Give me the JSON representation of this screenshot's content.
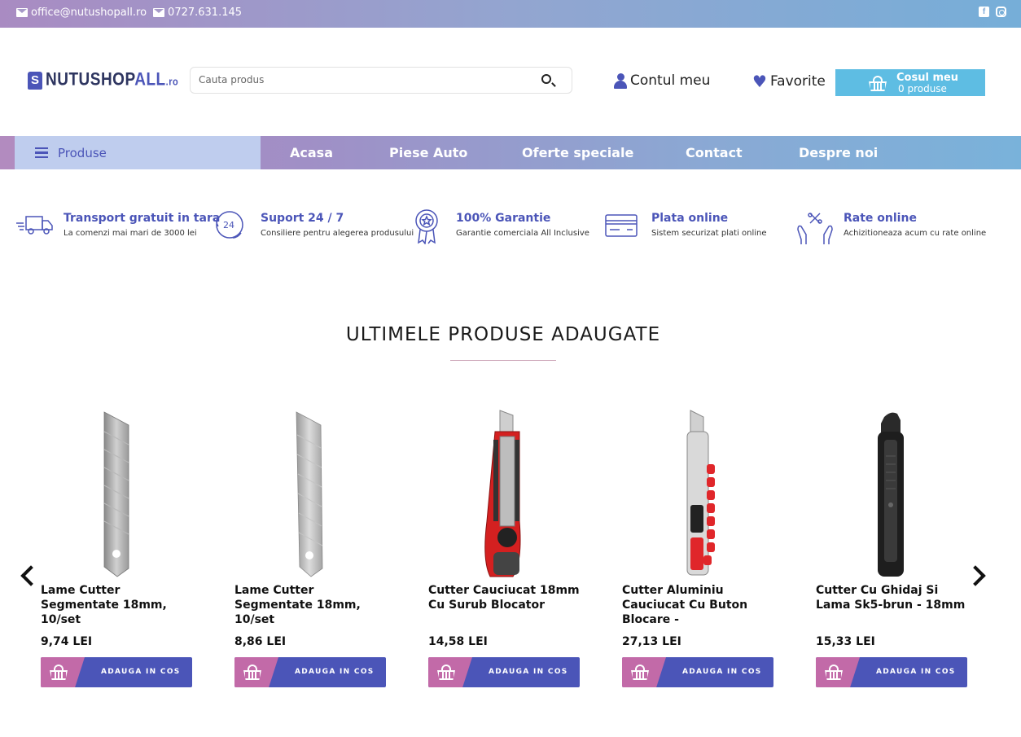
{
  "topbar": {
    "email": "office@nutushopall.ro",
    "phone": "0727.631.145",
    "facebook_glyph": "f"
  },
  "header": {
    "logo_main": "NUTUSHOP",
    "logo_accent": "ALL",
    "logo_tld": ".ro",
    "search_placeholder": "Cauta produs",
    "account_label": "Contul meu",
    "favorites_label": "Favorite",
    "cart_title": "Cosul meu",
    "cart_count": "0 produse"
  },
  "nav": {
    "products_label": "Produse",
    "links": [
      "Acasa",
      "Piese Auto",
      "Oferte speciale",
      "Contact",
      "Despre noi"
    ]
  },
  "features": [
    {
      "icon": "truck-icon",
      "title": "Transport gratuit in tara",
      "subtitle": "La comenzi mai mari de 3000 lei"
    },
    {
      "icon": "support-24-icon",
      "title": "Suport 24 / 7",
      "subtitle": "Consiliere pentru alegerea produsului"
    },
    {
      "icon": "guarantee-badge-icon",
      "title": "100% Garantie",
      "subtitle": "Garantie comerciala All Inclusive"
    },
    {
      "icon": "credit-card-icon",
      "title": "Plata online",
      "subtitle": "Sistem securizat plati online"
    },
    {
      "icon": "installments-hands-icon",
      "title": "Rate online",
      "subtitle": "Achizitioneaza acum cu rate online"
    }
  ],
  "section": {
    "title": "ULTIMELE PRODUSE ADAUGATE"
  },
  "products": [
    {
      "name": "Lame Cutter Segmentate 18mm, 10/set",
      "price": "9,74 LEI",
      "button": "ADAUGA IN COS",
      "image": "blade-icon"
    },
    {
      "name": "Lame Cutter Segmentate 18mm, 10/set",
      "price": "8,86 LEI",
      "button": "ADAUGA IN COS",
      "image": "blade-icon"
    },
    {
      "name": "Cutter Cauciucat 18mm Cu Surub Blocator",
      "price": "14,58 LEI",
      "button": "ADAUGA IN COS",
      "image": "cutter-red-icon"
    },
    {
      "name": "Cutter Aluminiu Cauciucat Cu Buton Blocare -",
      "price": "27,13 LEI",
      "button": "ADAUGA IN COS",
      "image": "cutter-aluminium-icon"
    },
    {
      "name": "Cutter Cu Ghidaj Si Lama Sk5-brun - 18mm",
      "price": "15,33 LEI",
      "button": "ADAUGA IN COS",
      "image": "cutter-black-icon"
    }
  ],
  "colors": {
    "brand_blue": "#4b55b8",
    "brand_pink": "#c26aa8",
    "cart_cyan": "#5ebde3"
  }
}
